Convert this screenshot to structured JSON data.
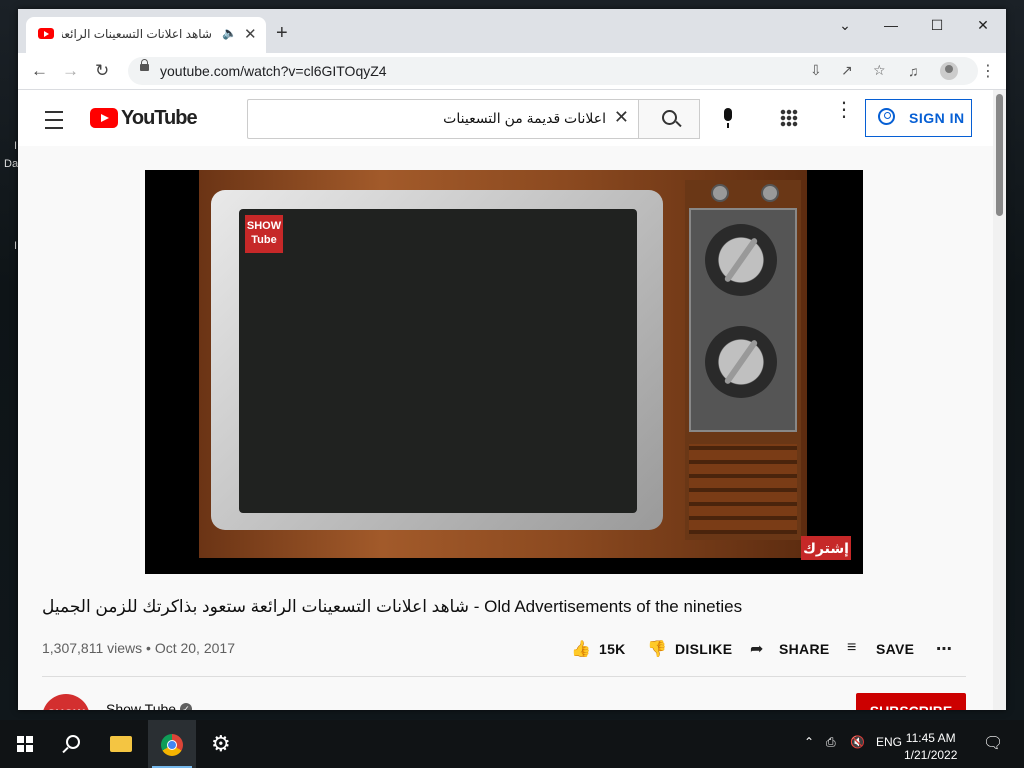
{
  "browser": {
    "tab_title": "شاهد اعلانات التسعينات الرائعة",
    "url": "youtube.com/watch?v=cl6GITOqyZ4"
  },
  "youtube": {
    "logo_text": "YouTube",
    "search_value": "اعلانات قديمة من التسعينات",
    "sign_in_label": "SIGN IN"
  },
  "video": {
    "channel_logo_text_1": "SHOW",
    "channel_logo_text_2": "Tube",
    "subscribe_overlay": "إشترك",
    "title": "شاهد اعلانات التسعينات الرائعة ستعود بذاكرتك للزمن الجميل - Old Advertisements of the nineties",
    "views_date": "1,307,811 views • Oct 20, 2017",
    "like_count": "15K",
    "dislike_label": "DISLIKE",
    "share_label": "SHARE",
    "save_label": "SAVE"
  },
  "channel": {
    "avatar_text": "SHOW",
    "name": "Show Tube",
    "subscribe_label": "SUBSCRIBE"
  },
  "taskbar": {
    "language": "ENG",
    "time": "11:45 AM",
    "date": "1/21/2022"
  },
  "desktop": {
    "side_text_1": "I",
    "side_text_2": "Da",
    "side_text_3": "I"
  },
  "colors": {
    "accent_blue": "#065fd4",
    "youtube_red": "#ff0000",
    "subscribe_red": "#cc0000"
  }
}
